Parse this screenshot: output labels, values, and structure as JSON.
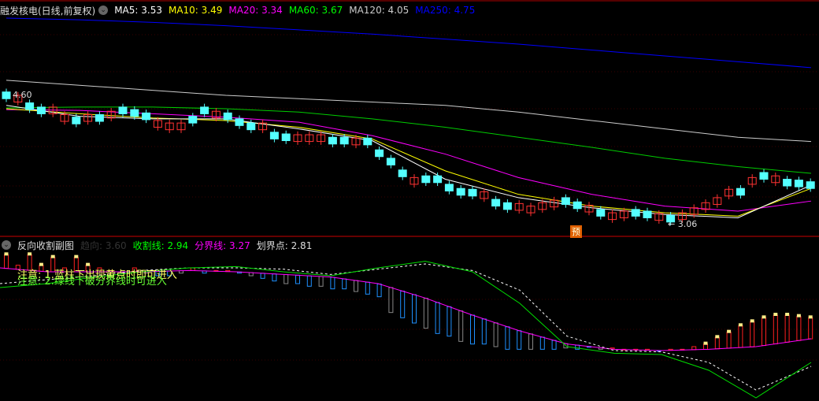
{
  "header": {
    "title": "融发核电(日线,前复权)",
    "ma": [
      {
        "label": "MA5: 3.53",
        "color": "#ffffff"
      },
      {
        "label": "MA10: 3.49",
        "color": "#ffff00"
      },
      {
        "label": "MA20: 3.34",
        "color": "#ff00ff"
      },
      {
        "label": "MA60: 3.67",
        "color": "#00ff00"
      },
      {
        "label": "MA120: 4.05",
        "color": "#cccccc"
      },
      {
        "label": "MA250: 4.75",
        "color": "#0000ff"
      }
    ]
  },
  "sub_header": {
    "title": "反向收割副图",
    "items": [
      {
        "label": "趋向: 3.60",
        "color": "#333333"
      },
      {
        "label": "收割线: 2.94",
        "color": "#00ff00"
      },
      {
        "label": "分界线: 3.27",
        "color": "#ff00ff"
      },
      {
        "label": "划界点: 2.81",
        "color": "#dddddd"
      }
    ]
  },
  "notes": [
    "注意: 1.蓝柱下出现黄点时即可进入",
    "注意: 2.绿线下破分界线时可进入"
  ],
  "markers": {
    "high_label": "4.60",
    "low_label": "3.06",
    "pre_label": "预"
  },
  "chart_data": [
    {
      "type": "candlestick",
      "name": "main",
      "mid": [
        4.6,
        4.56,
        4.47,
        4.42,
        4.42,
        4.33,
        4.3,
        4.33,
        4.33,
        4.37,
        4.42,
        4.39,
        4.35,
        4.26,
        4.23,
        4.23,
        4.31,
        4.42,
        4.37,
        4.35,
        4.28,
        4.23,
        4.23,
        4.12,
        4.1,
        4.09,
        4.09,
        4.09,
        4.06,
        4.06,
        4.05,
        4.05,
        3.91,
        3.81,
        3.67,
        3.58,
        3.6,
        3.6,
        3.5,
        3.45,
        3.44,
        3.41,
        3.32,
        3.28,
        3.27,
        3.24,
        3.28,
        3.31,
        3.34,
        3.29,
        3.25,
        3.2,
        3.16,
        3.18,
        3.2,
        3.18,
        3.15,
        3.13,
        3.16,
        3.22,
        3.28,
        3.34,
        3.44,
        3.45,
        3.58,
        3.64,
        3.6,
        3.56,
        3.55,
        3.53
      ],
      "dir": "dudduudududdduuuddudddudduuudduddddudddddudduuuudduduudduduuuuudududd",
      "ma_lines": {
        "MA60": [
          4.45,
          4.46,
          4.46,
          4.44,
          4.4,
          4.32,
          4.22,
          4.1,
          3.98,
          3.85,
          3.75,
          3.67
        ],
        "MA120": [
          4.78,
          4.72,
          4.66,
          4.6,
          4.56,
          4.52,
          4.48,
          4.4,
          4.3,
          4.2,
          4.1,
          4.05
        ],
        "MA250": [
          5.52,
          5.5,
          5.47,
          5.43,
          5.38,
          5.33,
          5.27,
          5.21,
          5.14,
          5.07,
          5.0,
          4.93
        ],
        "MA20": [
          4.43,
          4.42,
          4.38,
          4.34,
          4.28,
          4.12,
          3.9,
          3.62,
          3.42,
          3.28,
          3.22,
          3.34
        ],
        "MA10": [
          4.44,
          4.38,
          4.33,
          4.3,
          4.22,
          4.08,
          3.7,
          3.42,
          3.28,
          3.2,
          3.16,
          3.49
        ],
        "MA5": [
          4.48,
          4.35,
          4.32,
          4.32,
          4.2,
          4.06,
          3.6,
          3.38,
          3.26,
          3.18,
          3.14,
          3.53
        ]
      }
    },
    {
      "type": "line+bar",
      "name": "sub",
      "x": [
        0,
        60,
        120,
        180,
        240,
        300,
        360,
        420,
        480,
        540,
        600,
        660,
        720,
        780,
        840,
        900,
        960,
        1030
      ],
      "divide_line": [
        3.42,
        3.39,
        3.39,
        3.39,
        3.4,
        3.39,
        3.37,
        3.35,
        3.3,
        3.19,
        3.06,
        2.94,
        2.84,
        2.8,
        2.79,
        2.8,
        2.82,
        2.88
      ],
      "harvest_line": [
        3.27,
        3.3,
        3.35,
        3.39,
        3.42,
        3.43,
        3.39,
        3.36,
        3.42,
        3.47,
        3.39,
        3.15,
        2.82,
        2.77,
        2.76,
        2.64,
        2.43,
        2.7
      ],
      "trend_line": [
        3.3,
        3.33,
        3.36,
        3.4,
        3.42,
        3.42,
        3.41,
        3.37,
        3.41,
        3.45,
        3.4,
        3.25,
        2.9,
        2.79,
        2.78,
        2.7,
        2.49,
        2.67
      ],
      "bars": [
        3.52,
        3.44,
        3.52,
        3.44,
        3.5,
        3.42,
        3.5,
        3.44,
        3.42,
        3.4,
        3.38,
        3.42,
        3.38,
        3.36,
        3.36,
        3.38,
        3.42,
        3.38,
        3.4,
        3.4,
        3.38,
        3.36,
        3.34,
        3.32,
        3.3,
        3.3,
        3.28,
        3.28,
        3.26,
        3.26,
        3.24,
        3.22,
        3.2,
        3.08,
        3.04,
        3.0,
        2.96,
        2.92,
        2.9,
        2.86,
        2.84,
        2.84,
        2.82,
        2.8,
        2.8,
        2.8,
        2.8,
        2.8,
        2.81,
        2.8,
        2.82,
        2.8,
        2.81,
        2.8,
        2.8,
        2.8,
        2.79,
        2.8,
        2.8,
        2.82,
        2.84,
        2.89,
        2.93,
        2.98,
        3.01,
        3.04,
        3.06,
        3.06,
        3.05,
        3.04
      ]
    }
  ]
}
